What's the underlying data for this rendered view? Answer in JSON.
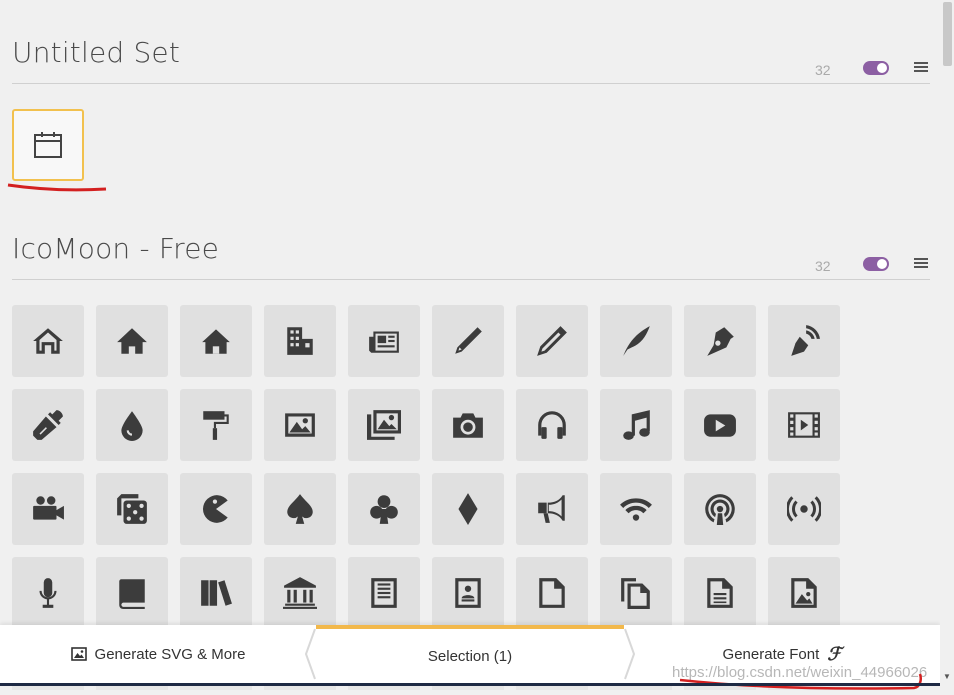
{
  "sets": [
    {
      "title": "Untitled Set",
      "grid_size": "32"
    },
    {
      "title": "IcoMoon - Free",
      "grid_size": "32"
    }
  ],
  "icons": [
    "home-icon",
    "home2-icon",
    "home3-icon",
    "office-icon",
    "newspaper-icon",
    "pencil-icon",
    "pencil2-icon",
    "quill-icon",
    "pen-icon",
    "blog-icon",
    "eyedropper-icon",
    "droplet-icon",
    "paint-format-icon",
    "image-icon",
    "images-icon",
    "camera-icon",
    "headphones-icon",
    "music-icon",
    "play-icon",
    "film-icon",
    "video-camera-icon",
    "dice-icon",
    "pacman-icon",
    "spades-icon",
    "clubs-icon",
    "diamonds-icon",
    "bullhorn-icon",
    "connection-icon",
    "podcast-icon",
    "feed-icon",
    "mic-icon",
    "book-icon",
    "books-icon",
    "library-icon",
    "file-text-icon",
    "profile-icon",
    "file-empty-icon",
    "files-empty-icon",
    "file-text2-icon",
    "file-picture-icon"
  ],
  "bottom_bar": {
    "generate_svg": "Generate SVG & More",
    "selection": "Selection (1)",
    "generate_font": "Generate Font",
    "font_glyph": "ℱ"
  },
  "watermark": "https://blog.csdn.net/weixin_44966026",
  "colors": {
    "accent": "#8c5fa3",
    "selection": "#f2b84b",
    "annotation": "#d32020"
  }
}
